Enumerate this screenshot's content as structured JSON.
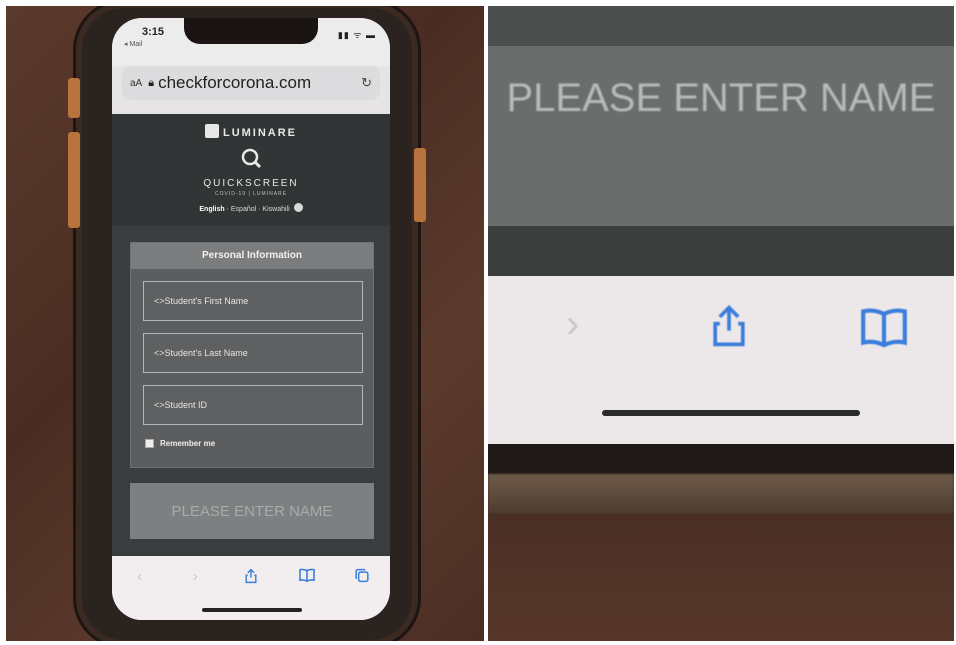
{
  "status_bar": {
    "time": "3:15",
    "back_label": "◂ Mail",
    "icons": "▮▮ ᯤ ▬"
  },
  "browser": {
    "text_size_label": "aA",
    "url": "checkforcorona.com",
    "lock_icon": "lock-icon",
    "reload_icon": "reload-icon"
  },
  "site_header": {
    "brand": "LUMINARE",
    "product": "QUICKSCREEN",
    "product_sub": "COVID-19 | LUMINARE",
    "languages": [
      "English",
      "Español",
      "Kiswahili"
    ]
  },
  "form": {
    "title": "Personal Information",
    "first_name_placeholder": "<>Student's First Name",
    "last_name_placeholder": "<>Student's Last Name",
    "student_id_placeholder": "<>Student ID",
    "remember_label": "Remember me",
    "submit_label": "PLEASE ENTER NAME"
  },
  "toolbar": {
    "back_glyph": "‹",
    "forward_glyph": "›",
    "icons": [
      "back-icon",
      "forward-icon",
      "share-icon",
      "bookmarks-icon",
      "tabs-icon"
    ]
  },
  "zoom": {
    "submit_label": "PLEASE ENTER NAME",
    "chevron_glyph": "›"
  },
  "colors": {
    "accent": "#3b7ddb",
    "header_bg": "#323536",
    "button_bg": "#7d7f80"
  }
}
